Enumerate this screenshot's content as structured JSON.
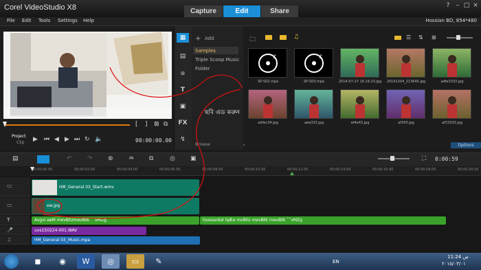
{
  "window": {
    "title": "Corel VideoStudio X8",
    "project_info": "Hossian BD, 854*480"
  },
  "tabs": [
    {
      "label": "Capture"
    },
    {
      "label": "Edit"
    },
    {
      "label": "Share"
    }
  ],
  "menu": [
    "File",
    "Edit",
    "Tools",
    "Settings",
    "Help"
  ],
  "preview": {
    "project_label": "Project",
    "clip_label": "Clip",
    "timecode": "00:00:00.00"
  },
  "library": {
    "add_label": "Add",
    "folders": [
      "Samples",
      "Triple Scoop Music",
      "Folder"
    ],
    "browse_label": "Browse",
    "options_label": "Options",
    "items": [
      {
        "name": "SP-S02.mpa",
        "kind": "audio"
      },
      {
        "name": "SP-S03.mpa",
        "kind": "audio"
      },
      {
        "name": "2014-07-27 16.19.23.jpg",
        "kind": "photo"
      },
      {
        "name": "20141204_213645.jpg",
        "kind": "photo"
      },
      {
        "name": "adfe3333.jpg",
        "kind": "photo"
      },
      {
        "name": "adfec34.jpg",
        "kind": "photo"
      },
      {
        "name": "aee333.jpg",
        "kind": "photo"
      },
      {
        "name": "af4e43.jpg",
        "kind": "photo"
      },
      {
        "name": "af343.jpg",
        "kind": "photo"
      },
      {
        "name": "af33333.jpg",
        "kind": "photo"
      }
    ]
  },
  "annotation": "ছবি এড করুন",
  "timeline": {
    "timecode": "0:00:59",
    "ruler": [
      "00:00:00.00",
      "00:00:02.00",
      "00:00:04.00",
      "00:00:06.00",
      "00:00:08.00",
      "00:00:10.00",
      "00:00:12.00",
      "00:00:14.00",
      "00:00:16.00",
      "00:00:18.00",
      "00:00:20.00"
    ],
    "clips": {
      "video": "HM_General 03_Start.wmv",
      "overlay": "ew.jpg",
      "title1": "Avgvi eøM mevBtUmevBtK ˆ˜vMZg.",
      "title2": "hossianbd lqÆe mvBtU mevBtK mevBtK ˆ˜vMZg",
      "voice": "uvs150224-001.WAV",
      "music": "HM_General 03_Music.mpa"
    }
  },
  "taskbar": {
    "lang": "EN",
    "time": "11:24 ص",
    "date": "٢٠١٥/٠٣/٠١"
  },
  "colors": {
    "accent": "#1a8fd8",
    "video_clip": "#0f7a63",
    "title_clip": "#3aa22a",
    "voice_clip": "#7a2aa0",
    "music_clip": "#1f6fb5",
    "annotation": "#d11111"
  }
}
